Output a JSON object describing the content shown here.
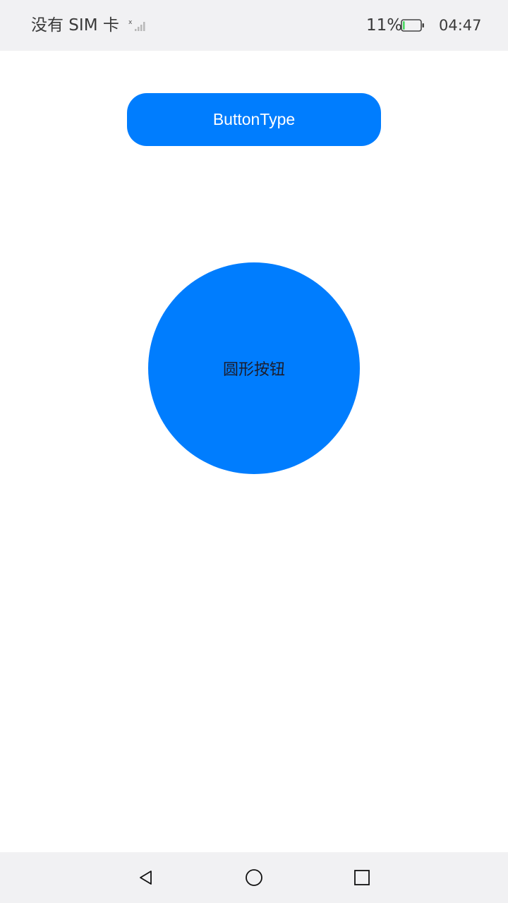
{
  "colors": {
    "accent": "#007dfe",
    "status_bar_bg": "#f1f1f3",
    "battery_fill": "#4cd964"
  },
  "status_bar": {
    "carrier": "没有 SIM 卡",
    "battery_percent": "11%",
    "battery_level": 0.11,
    "time": "04:47",
    "icons": [
      "signal-icon",
      "battery-icon"
    ]
  },
  "main": {
    "button_type_label": "ButtonType",
    "circle_button_label": "圆形按钮"
  },
  "nav_bar": {
    "icons": [
      "back-icon",
      "home-icon",
      "recent-apps-icon"
    ]
  }
}
